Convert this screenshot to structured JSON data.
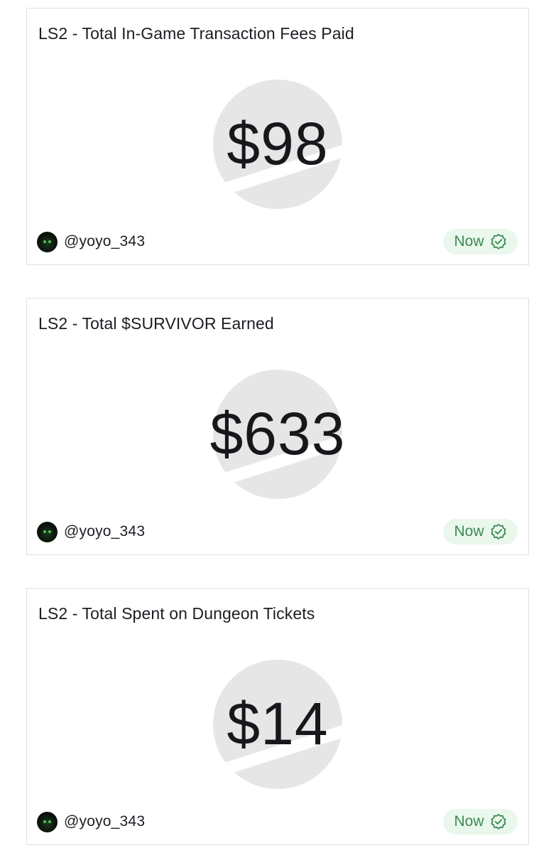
{
  "cards": [
    {
      "title": "LS2 - Total In-Game Transaction Fees Paid",
      "value": "$98",
      "author": {
        "handle": "@yoyo_343",
        "avatar_icon": "avatar-icon"
      },
      "status": {
        "label": "Now",
        "icon": "verified-check-icon"
      }
    },
    {
      "title": "LS2 - Total $SURVIVOR Earned",
      "value": "$633",
      "author": {
        "handle": "@yoyo_343",
        "avatar_icon": "avatar-icon"
      },
      "status": {
        "label": "Now",
        "icon": "verified-check-icon"
      }
    },
    {
      "title": "LS2 - Total Spent on Dungeon Tickets",
      "value": "$14",
      "author": {
        "handle": "@yoyo_343",
        "avatar_icon": "avatar-icon"
      },
      "status": {
        "label": "Now",
        "icon": "verified-check-icon"
      }
    }
  ],
  "colors": {
    "status_bg": "#eaf7ec",
    "status_text": "#3a8a55",
    "placeholder_circle": "#e6e6e6",
    "card_border": "#e1e1e1"
  }
}
